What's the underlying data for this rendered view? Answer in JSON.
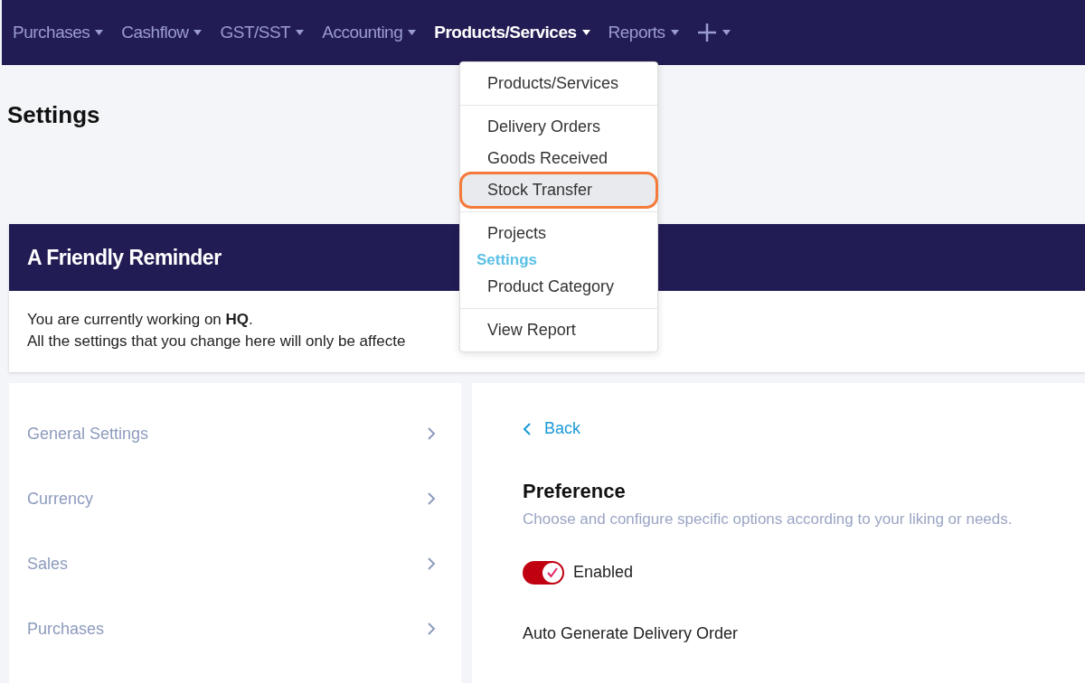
{
  "nav": {
    "items": [
      {
        "label": "Purchases",
        "selected": false
      },
      {
        "label": "Cashflow",
        "selected": false
      },
      {
        "label": "GST/SST",
        "selected": false
      },
      {
        "label": "Accounting",
        "selected": false
      },
      {
        "label": "Products/Services",
        "selected": true
      },
      {
        "label": "Reports",
        "selected": false
      }
    ],
    "add_menu": true
  },
  "dropdown": {
    "groups": [
      {
        "items": [
          {
            "kind": "item",
            "label": "Products/Services",
            "selected": false
          }
        ]
      },
      {
        "items": [
          {
            "kind": "item",
            "label": "Delivery Orders",
            "selected": false
          },
          {
            "kind": "item",
            "label": "Goods Received",
            "selected": false
          },
          {
            "kind": "item",
            "label": "Stock Transfer",
            "selected": true
          }
        ]
      },
      {
        "items": [
          {
            "kind": "item",
            "label": "Projects",
            "selected": false
          },
          {
            "kind": "heading",
            "label": "Settings"
          },
          {
            "kind": "item",
            "label": "Product Category",
            "selected": false
          }
        ]
      },
      {
        "items": [
          {
            "kind": "item",
            "label": "View Report",
            "selected": false
          }
        ]
      }
    ]
  },
  "page_title": "Settings",
  "reminder": {
    "title": "A Friendly Reminder",
    "lines": [
      "You are currently working on **HQ**.",
      "All the settings that you change here will only be affecte"
    ]
  },
  "sidebar": {
    "items": [
      {
        "label": "General Settings"
      },
      {
        "label": "Currency"
      },
      {
        "label": "Sales"
      },
      {
        "label": "Purchases"
      }
    ]
  },
  "content": {
    "back": "Back",
    "title": "Preference",
    "subtitle": "Choose and configure specific options according to your liking or needs.",
    "toggle": {
      "label": "Enabled",
      "on": true
    },
    "field_label": "Auto Generate Delivery Order"
  }
}
